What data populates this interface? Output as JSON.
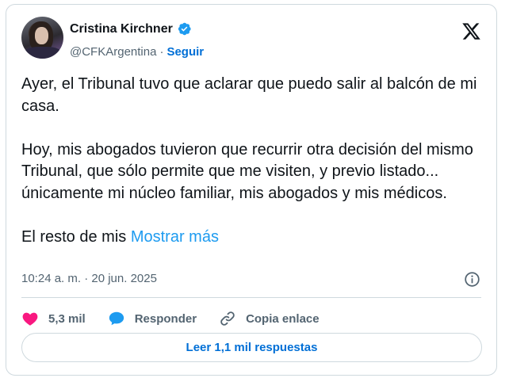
{
  "author": {
    "name": "Cristina Kirchner",
    "handle": "@CFKArgentina",
    "separator": "·",
    "follow_label": "Seguir"
  },
  "tweet": {
    "paragraph_1": "Ayer, el Tribunal tuvo que aclarar que puedo salir al balcón de mi casa.",
    "paragraph_2": "Hoy, mis abogados tuvieron que recurrir otra decisión del mismo Tribunal, que sólo permite que me visiten, y previo listado... únicamente mi núcleo familiar, mis abogados y mis médicos.",
    "paragraph_3": "El resto de mis",
    "show_more": "Mostrar más",
    "timestamp": "10:24 a. m. · 20 jun. 2025"
  },
  "actions": {
    "likes": "5,3 mil",
    "reply_label": "Responder",
    "copy_link_label": "Copia enlace"
  },
  "read_replies_label": "Leer 1,1 mil respuestas",
  "colors": {
    "verified": "#1d9bf0",
    "link": "#1d9bf0",
    "like_heart": "#f91880",
    "reply_bubble": "#1d9bf0",
    "button_text": "#006fd6",
    "muted_text": "#536471",
    "border": "#cfd9de"
  },
  "icons": [
    "verified-badge-icon",
    "x-logo-icon",
    "info-icon",
    "heart-icon",
    "reply-bubble-icon",
    "link-icon"
  ]
}
